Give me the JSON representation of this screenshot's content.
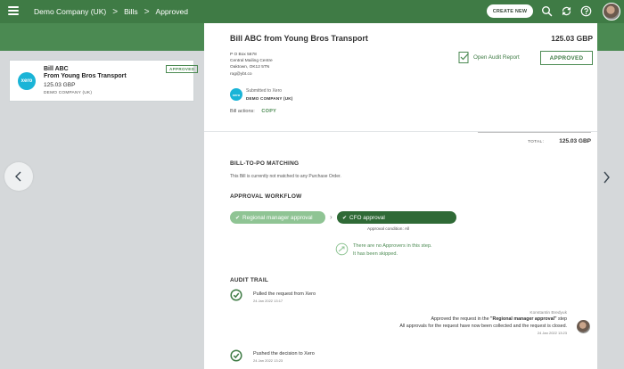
{
  "topbar": {
    "breadcrumbs": [
      "Demo Company (UK)",
      "Bills",
      "Approved"
    ],
    "separator": ">",
    "create_button": "CREATE NEW",
    "icons": [
      "menu-icon",
      "search-icon",
      "sync-icon",
      "help-icon",
      "user-avatar"
    ]
  },
  "list": {
    "card": {
      "logo": "xero",
      "title_line1": "Bill ABC",
      "title_line2": "From Young Bros Transport",
      "amount": "125.03 GBP",
      "company": "DEMO COMPANY (UK)",
      "badge": "APPROVED"
    }
  },
  "detail": {
    "title": "Bill ABC from Young Bros Transport",
    "amount": "125.03 GBP",
    "address": [
      "P O Box 5678",
      "Central Mailing Centre",
      "Oaktown, OK12 5TN",
      "rog@ybt.co"
    ],
    "audit_link": "Open Audit Report",
    "status_button": "APPROVED",
    "submitted_to": "Submitted to Xero",
    "submitted_company": "DEMO COMPANY (UK)",
    "actions_label": "Bill actions:",
    "copy_label": "COPY",
    "total_label": "TOTAL:",
    "total_value": "125.03 GBP",
    "po_section": {
      "title": "BILL-TO-PO MATCHING",
      "note": "This Bill is currently not matched to any Purchase Order."
    },
    "workflow": {
      "title": "APPROVAL WORKFLOW",
      "steps": [
        {
          "label": "Regional manager approval"
        },
        {
          "label": "CFO approval"
        }
      ],
      "condition": "Approval condition: All",
      "no_approvers": [
        "There are no Approvers in this step.",
        "It has been skipped."
      ]
    },
    "audit": {
      "title": "AUDIT TRAIL",
      "entries": [
        {
          "text": "Pulled the request from Xero",
          "date": "24 Jan 2022 13:17"
        },
        {
          "who": "Konstantin Bredyuk",
          "line1_pre": "Approved the request in the ",
          "line1_bold": "\"Regional manager approval\"",
          "line1_post": " step",
          "line2": "All approvals for the request have now been collected and the request is closed.",
          "date": "24 Jan 2022 13:23"
        },
        {
          "text": "Pushed the decision to Xero",
          "date": "24 Jan 2022 13:23"
        }
      ]
    }
  },
  "colors": {
    "topbar": "#3f7b45",
    "band": "#4b8a52",
    "step_done": "#8fc494",
    "step_active": "#2f6a36",
    "xero": "#1ab4d7"
  }
}
